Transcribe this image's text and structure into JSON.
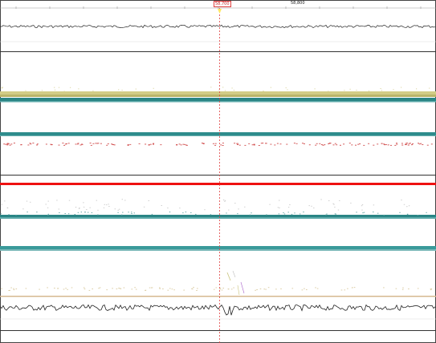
{
  "ruler": {
    "cursor_label": "58,700",
    "mark_label": "58,800"
  },
  "tracks": [
    {
      "id": "signal-top",
      "kind": "wave",
      "color": "#222222"
    },
    {
      "id": "band-olive",
      "kind": "band",
      "color": "#c8c27a"
    },
    {
      "id": "band-teal-1",
      "kind": "band",
      "color": "#2a8a8a"
    },
    {
      "id": "band-teal-2",
      "kind": "band",
      "color": "#2a8a8a"
    },
    {
      "id": "dots-red",
      "kind": "dots",
      "color": "#d04a4a"
    },
    {
      "id": "line-red",
      "kind": "band",
      "color": "#ee1111"
    },
    {
      "id": "band-teal-3",
      "kind": "band",
      "color": "#2a8a8a"
    },
    {
      "id": "band-teal-4",
      "kind": "band",
      "color": "#3a9a9a"
    },
    {
      "id": "band-tan",
      "kind": "band",
      "color": "#d6b890"
    },
    {
      "id": "signal-bottom",
      "kind": "wave",
      "color": "#222222"
    }
  ],
  "colors": {
    "cursor": "#e04040",
    "separator": "#333333",
    "frame": "#444444"
  }
}
